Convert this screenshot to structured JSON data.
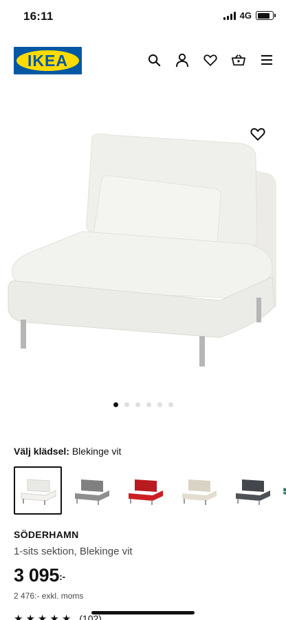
{
  "status_bar": {
    "time": "16:11",
    "network": "4G"
  },
  "header": {
    "logo_text": "IKEA"
  },
  "product": {
    "upholstery_label": "Välj klädsel:",
    "upholstery_value": "Blekinge vit",
    "name": "SÖDERHAMN",
    "description": "1-sits sektion, Blekinge vit",
    "price": "3 095",
    "price_suffix": ":-",
    "price_ex_vat": "2 476:- exkl. moms",
    "review_count": "(102)",
    "carousel": {
      "total": 6,
      "active": 1
    },
    "swatches": [
      {
        "color": "#f2f1ee",
        "name": "Blekinge vit",
        "selected": true
      },
      {
        "color": "#8e8e8e",
        "name": "grå"
      },
      {
        "color": "#cc1f24",
        "name": "röd"
      },
      {
        "color": "#e3ddd0",
        "name": "beige"
      },
      {
        "color": "#4e5256",
        "name": "mörkgrå"
      },
      {
        "color": "#2f8073",
        "name": "grön"
      }
    ]
  },
  "colors": {
    "brand_blue": "#0058a3",
    "brand_yellow": "#ffdb00"
  },
  "icons": [
    "search-icon",
    "user-icon",
    "heart-icon",
    "basket-icon",
    "menu-icon",
    "favourite-icon"
  ]
}
